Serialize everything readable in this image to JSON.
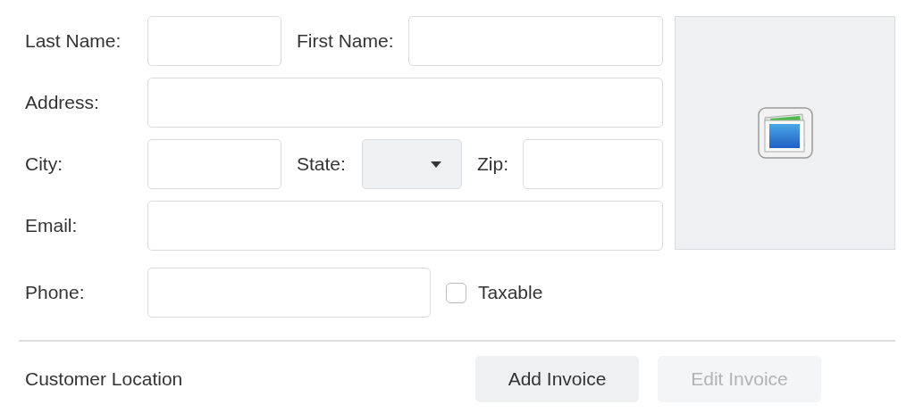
{
  "form": {
    "rows": [
      {
        "items": [
          {
            "kind": "label",
            "text": "Last Name:"
          },
          {
            "kind": "input"
          },
          {
            "kind": "label",
            "text": "First Name:"
          },
          {
            "kind": "input"
          }
        ]
      },
      {
        "items": [
          {
            "kind": "label",
            "text": "Address:"
          },
          {
            "kind": "input"
          }
        ]
      },
      {
        "items": [
          {
            "kind": "label",
            "text": "City:"
          },
          {
            "kind": "input"
          },
          {
            "kind": "label",
            "text": "State:"
          },
          {
            "kind": "select"
          },
          {
            "kind": "label",
            "text": "Zip:"
          },
          {
            "kind": "input"
          }
        ]
      },
      {
        "items": [
          {
            "kind": "label",
            "text": "Email:"
          },
          {
            "kind": "input"
          }
        ]
      },
      {
        "items": [
          {
            "kind": "label",
            "text": "Phone:"
          },
          {
            "kind": "input"
          },
          {
            "kind": "checkbox",
            "label": "Taxable",
            "checked": false
          }
        ]
      }
    ]
  },
  "footer": {
    "label": "Customer Location",
    "buttons": [
      {
        "label": "Add Invoice",
        "disabled": false
      },
      {
        "label": "Edit Invoice",
        "disabled": true
      }
    ]
  }
}
